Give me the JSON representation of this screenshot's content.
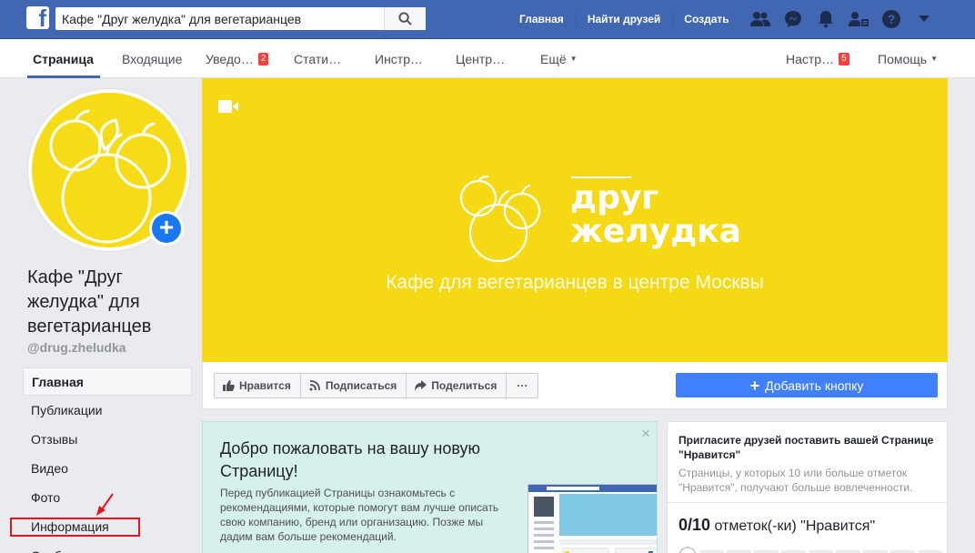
{
  "topbar": {
    "logo": "f",
    "search_value": "Кафе \"Друг желудка\" для вегетарианцев",
    "links": [
      "Главная",
      "Найти друзей",
      "Создать"
    ],
    "icons": [
      "friends-icon",
      "messenger-icon",
      "notifications-bell-icon",
      "friend-requests-icon",
      "help-icon",
      "dropdown-caret-icon"
    ]
  },
  "subnav": {
    "tabs": [
      {
        "label": "Страница"
      },
      {
        "label": "Входящие"
      },
      {
        "label": "Уведо…",
        "badge": "2"
      },
      {
        "label": "Стати…"
      },
      {
        "label": "Инстр…"
      },
      {
        "label": "Центр…"
      },
      {
        "label": "Ещё"
      }
    ],
    "settings": {
      "label": "Настр…",
      "badge": "5"
    },
    "help": {
      "label": "Помощь"
    }
  },
  "page": {
    "name": "Кафе \"Друг желудка\" для вегетарианцев",
    "handle": "@drug.zheludka",
    "avatar_add": "+"
  },
  "side_menu": [
    "Главная",
    "Публикации",
    "Отзывы",
    "Видео",
    "Фото",
    "Информация",
    "Сообщество"
  ],
  "cover": {
    "logo_line1": "друг",
    "logo_line2": "желудка",
    "tagline": "Кафе для вегетарианцев в центре Москвы"
  },
  "actions": {
    "like": "Нравится",
    "follow": "Подписаться",
    "share": "Поделиться",
    "more": "···",
    "add_button": "Добавить кнопку"
  },
  "welcome": {
    "close": "×",
    "title": "Добро пожаловать на вашу новую Страницу!",
    "text": "Перед публикацией Страницы ознакомьтесь с рекомендациями, которые помогут вам лучше описать свою компанию, бренд или организацию. Позже мы дадим вам больше рекомендаций."
  },
  "invite": {
    "title": "Пригласите друзей поставить вашей Странице \"Нравится\"",
    "subtitle": "Страницы, у которых 10 или больше отметок \"Нравится\", получают больше вовлеченности.",
    "count": "0/10",
    "count_label": "отметок(-ки) \"Нравится\"",
    "progress": 0
  },
  "colors": {
    "brand_blue": "#4267b2",
    "cover_yellow": "#f5d915",
    "accent_blue": "#4080ff",
    "highlight_red": "#e8141b",
    "badge_red": "#fa3e3e"
  }
}
